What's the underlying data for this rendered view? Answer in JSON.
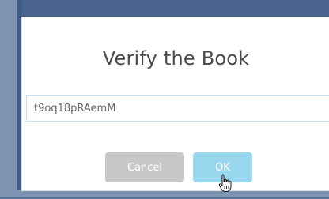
{
  "dialog": {
    "title": "Verify the Book",
    "input_value": "t9oq18pRAemM",
    "cancel_label": "Cancel",
    "ok_label": "OK"
  },
  "colors": {
    "backdrop": "#4a6590",
    "ok_button": "#99d7ef",
    "cancel_button": "#c8c8c8",
    "title_text": "#4a4a4a"
  },
  "icons": {
    "cursor": "hand-pointer-icon"
  }
}
